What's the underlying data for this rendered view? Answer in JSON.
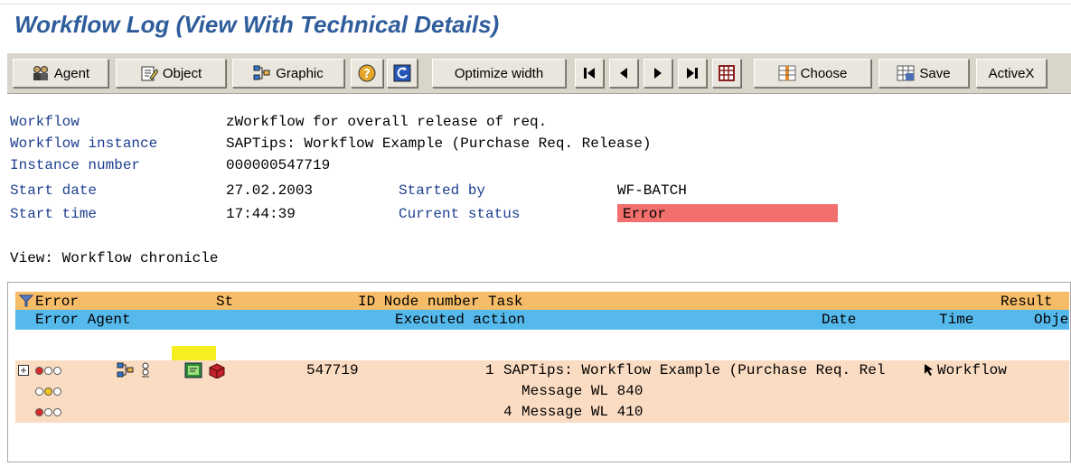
{
  "title": "Workflow Log (View With Technical Details)",
  "toolbar": {
    "agent": "Agent",
    "object": "Object",
    "graphic": "Graphic",
    "optimize_width": "Optimize width",
    "choose": "Choose",
    "save": "Save",
    "activex": "ActiveX"
  },
  "header": {
    "workflow_label": "Workflow",
    "workflow_value": "zWorkflow for overall release of req.",
    "instance_label": "Workflow instance",
    "instance_value": "SAPTips: Workflow Example (Purchase Req. Release)",
    "number_label": "Instance number",
    "number_value": "000000547719",
    "start_date_label": "Start date",
    "start_date_value": "27.02.2003",
    "started_by_label": "Started by",
    "started_by_value": "WF-BATCH",
    "start_time_label": "Start time",
    "start_time_value": "17:44:39",
    "status_label": "Current status",
    "status_value": "Error"
  },
  "view_label": "View: Workflow chronicle",
  "grid": {
    "header1": {
      "error": "Error",
      "st": "St",
      "id_node_task": "ID Node number Task",
      "result": "Result"
    },
    "header2": {
      "error_agent": "Error Agent",
      "executed_action": "Executed action",
      "date": "Date",
      "time": "Time",
      "object": "Obje"
    },
    "rows": [
      {
        "id": "547719",
        "node": "1",
        "task": "SAPTips: Workflow Example (Purchase Req. Rel",
        "result": "Workflow"
      },
      {
        "node": "",
        "task": "Message WL 840"
      },
      {
        "node": "4",
        "task": "Message WL 410"
      }
    ]
  },
  "colors": {
    "title": "#2f5d9c",
    "error": "#f1706d",
    "header1": "#f6bc68",
    "header2": "#56b9ec",
    "row": "#fadcc2",
    "highlight": "#f6ee21"
  },
  "icons": [
    "agent-icon",
    "object-icon",
    "graphic-icon",
    "help-icon",
    "refresh-icon",
    "first-page-icon",
    "prev-page-icon",
    "next-page-icon",
    "last-page-icon",
    "grid-icon",
    "choose-icon",
    "save-icon",
    "filter-icon",
    "expand-icon",
    "traffic-light-icon",
    "workitem-icon"
  ]
}
